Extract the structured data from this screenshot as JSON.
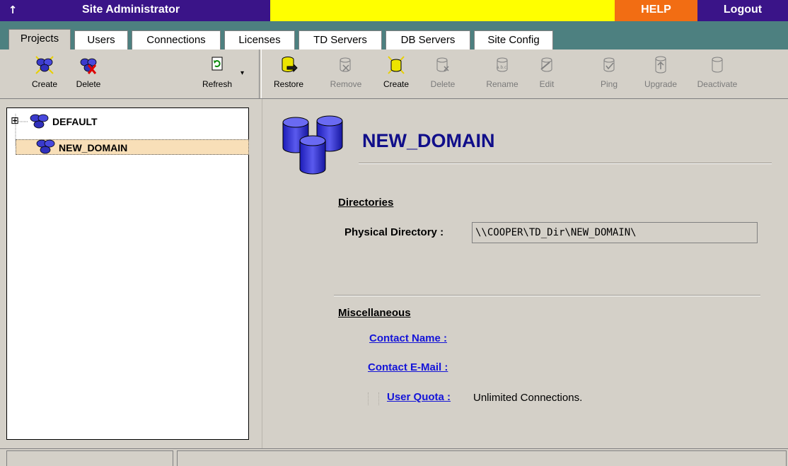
{
  "header": {
    "up_arrow": "↑",
    "title": "Site Administrator",
    "help": "HELP",
    "logout": "Logout"
  },
  "tabs": [
    "Projects",
    "Users",
    "Connections",
    "Licenses",
    "TD Servers",
    "DB Servers",
    "Site Config"
  ],
  "active_tab": "Projects",
  "left_toolbar": {
    "create": "Create",
    "delete": "Delete",
    "refresh": "Refresh"
  },
  "right_toolbar": {
    "restore": "Restore",
    "remove": "Remove",
    "create": "Create",
    "delete": "Delete",
    "rename": "Rename",
    "edit": "Edit",
    "ping": "Ping",
    "upgrade": "Upgrade",
    "deactivate": "Deactivate"
  },
  "tree": {
    "expander": "⊞",
    "items": [
      "DEFAULT",
      "NEW_DOMAIN"
    ],
    "selected": "NEW_DOMAIN"
  },
  "detail": {
    "domain_name": "NEW_DOMAIN",
    "directories_heading": "Directories",
    "physical_directory_label": "Physical Directory :",
    "physical_directory_value": "\\\\COOPER\\TD_Dir\\NEW_DOMAIN\\",
    "misc_heading": "Miscellaneous",
    "contact_name_label": "Contact Name :",
    "contact_email_label": "Contact E-Mail :",
    "user_quota_label": "User Quota :",
    "user_quota_value": "Unlimited Connections."
  },
  "colors": {
    "title_bar": "#3a1488",
    "help_bar": "#f26d13",
    "yellow_bar": "#ffff00",
    "tab_strip": "#4d8080",
    "link": "#1414d8",
    "domain_title": "#100e8a",
    "selection": "#f8dfb8"
  }
}
